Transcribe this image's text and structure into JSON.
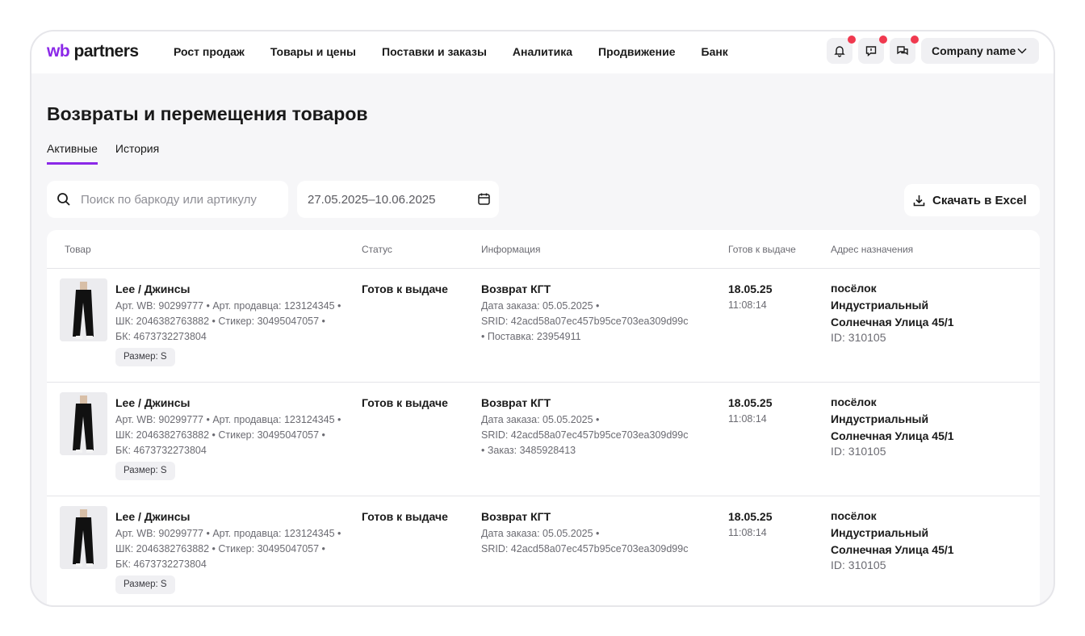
{
  "brand": {
    "wb": "wb",
    "partners": "partners"
  },
  "nav": [
    "Рост продаж",
    "Товары и цены",
    "Поставки и заказы",
    "Аналитика",
    "Продвижение",
    "Банк"
  ],
  "header": {
    "company": "Company name"
  },
  "page": {
    "title": "Возвраты и перемещения товаров"
  },
  "tabs": [
    {
      "label": "Активные",
      "active": true
    },
    {
      "label": "История",
      "active": false
    }
  ],
  "filters": {
    "search_placeholder": "Поиск по баркоду или артикулу",
    "date_range": "27.05.2025–10.06.2025",
    "excel_label": "Скачать в Excel"
  },
  "columns": [
    "Товар",
    "Статус",
    "Информация",
    "Готов к выдаче",
    "Адрес назначения"
  ],
  "rows": [
    {
      "name": "Lee / Джинсы",
      "meta1": "Арт. WB: 90299777 • Арт. продавца: 123124345 •",
      "meta2": "ШК: 2046382763882 • Стикер: 30495047057 •",
      "meta3": "БК: 4673732273804",
      "size": "Размер: S",
      "status": "Готов к выдаче",
      "info_title": "Возврат КГТ",
      "info1": "Дата заказа: 05.05.2025 •",
      "info2": "SRID: 42acd58a07ec457b95ce703ea309d99c",
      "info3": "• Поставка: 23954911",
      "date": "18.05.25",
      "time": "11:08:14",
      "addr1": "посёлок",
      "addr2": "Индустриальный",
      "addr3": "Солнечная Улица 45/1",
      "addr_id": "ID: 310105"
    },
    {
      "name": "Lee / Джинсы",
      "meta1": "Арт. WB: 90299777 • Арт. продавца: 123124345 •",
      "meta2": "ШК: 2046382763882 • Стикер: 30495047057 •",
      "meta3": "БК: 4673732273804",
      "size": "Размер: S",
      "status": "Готов к выдаче",
      "info_title": "Возврат КГТ",
      "info1": "Дата заказа: 05.05.2025 •",
      "info2": "SRID: 42acd58a07ec457b95ce703ea309d99c",
      "info3": "• Заказ: 3485928413",
      "date": "18.05.25",
      "time": "11:08:14",
      "addr1": "посёлок",
      "addr2": "Индустриальный",
      "addr3": "Солнечная Улица 45/1",
      "addr_id": "ID: 310105"
    },
    {
      "name": "Lee / Джинсы",
      "meta1": "Арт. WB: 90299777 • Арт. продавца: 123124345 •",
      "meta2": "ШК: 2046382763882 • Стикер: 30495047057 •",
      "meta3": "БК: 4673732273804",
      "size": "Размер: S",
      "status": "Готов к выдаче",
      "info_title": "Возврат КГТ",
      "info1": "Дата заказа: 05.05.2025 •",
      "info2": "SRID: 42acd58a07ec457b95ce703ea309d99c",
      "info3": "",
      "date": "18.05.25",
      "time": "11:08:14",
      "addr1": "посёлок",
      "addr2": "Индустриальный",
      "addr3": "Солнечная Улица 45/1",
      "addr_id": "ID: 310105"
    }
  ],
  "colors": {
    "accent": "#8b28e8",
    "badge": "#f0394f"
  },
  "icons": [
    "search-icon",
    "calendar-icon",
    "download-icon",
    "bell-icon",
    "feedback-icon",
    "chat-icon",
    "chevron-down-icon"
  ]
}
